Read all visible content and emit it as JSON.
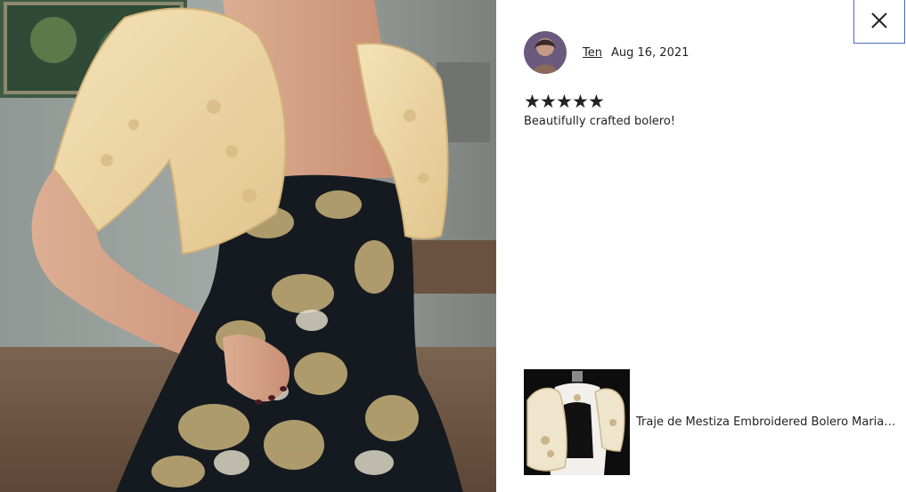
{
  "photo": {
    "alt": "Review photo of embroidered bolero over gold and black brocade gown"
  },
  "review": {
    "reviewer_name": "Ten",
    "date": "Aug 16, 2021",
    "rating": 5,
    "rating_max": 5,
    "stars": [
      "★",
      "★",
      "★",
      "★",
      "★"
    ],
    "text": "Beautifully crafted bolero!"
  },
  "product": {
    "title": "Traje de Mestiza Embroidered Bolero Maria Clara"
  },
  "icons": {
    "close": "close-icon",
    "star": "star-icon"
  },
  "colors": {
    "close_border": "#4d6bc6",
    "text": "#222222",
    "background": "#ffffff"
  }
}
